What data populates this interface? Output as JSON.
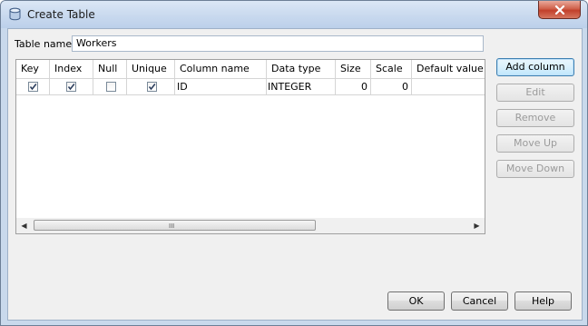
{
  "window": {
    "title": "Create Table",
    "close_icon": "close-x-icon",
    "app_icon": "database-cylinder-icon"
  },
  "table_name": {
    "label": "Table name:",
    "value": "Workers"
  },
  "grid": {
    "columns": [
      "Key",
      "Index",
      "Null",
      "Unique",
      "Column name",
      "Data type",
      "Size",
      "Scale",
      "Default value"
    ],
    "rows": [
      {
        "key": true,
        "index": true,
        "null": false,
        "unique": true,
        "column_name": "ID",
        "data_type": "INTEGER",
        "size": "0",
        "scale": "0",
        "default_value": ""
      }
    ],
    "scroll_grip": "III"
  },
  "side_buttons": {
    "add_column": "Add column",
    "edit": "Edit",
    "remove": "Remove",
    "move_up": "Move Up",
    "move_down": "Move Down"
  },
  "footer_buttons": {
    "ok": "OK",
    "cancel": "Cancel",
    "help": "Help"
  },
  "colors": {
    "titlebar": "#c7d8ee",
    "close_button": "#c2402b",
    "dialog_bg": "#f0f0f0",
    "primary_button_border": "#3c7fb1"
  }
}
